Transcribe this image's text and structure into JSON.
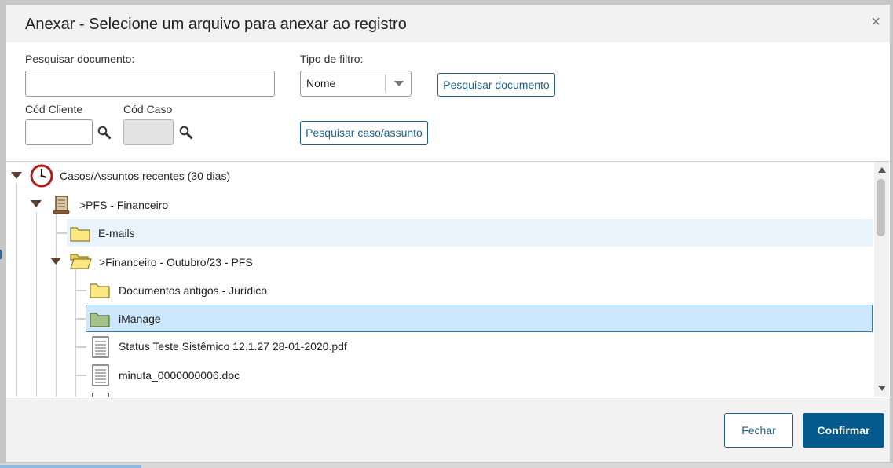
{
  "dialog": {
    "title": "Anexar - Selecione um arquivo para anexar ao registro",
    "close_label": "×"
  },
  "search": {
    "document_label": "Pesquisar documento:",
    "document_value": "",
    "filter_type_label": "Tipo de filtro:",
    "filter_type_value": "Nome",
    "search_document_button": "Pesquisar documento",
    "client_code_label": "Cód Cliente",
    "client_code_value": "",
    "case_code_label": "Cód Caso",
    "case_code_value": "",
    "search_case_button": "Pesquisar caso/assunto"
  },
  "tree": {
    "nodes": [
      {
        "label": "Casos/Assuntos recentes (30 dias)",
        "icon": "clock-icon",
        "expanded": true
      },
      {
        "label": ">PFS - Financeiro",
        "icon": "scroll-icon",
        "expanded": true
      },
      {
        "label": "E-mails",
        "icon": "folder-icon",
        "hovered": true
      },
      {
        "label": ">Financeiro - Outubro/23 - PFS",
        "icon": "folder-open-icon",
        "expanded": true
      },
      {
        "label": "Documentos antigos - Jurídico",
        "icon": "folder-icon"
      },
      {
        "label": "iManage",
        "icon": "folder-green-icon",
        "selected": true
      },
      {
        "label": "Status Teste Sistêmico 12.1.27 28-01-2020.pdf",
        "icon": "document-icon"
      },
      {
        "label": "minuta_0000000006.doc",
        "icon": "document-icon"
      }
    ]
  },
  "footer": {
    "close_button": "Fechar",
    "confirm_button": "Confirmar"
  },
  "colors": {
    "primary": "#045a8d",
    "outline": "#1f5f8b",
    "hover_row": "#e8f3fc",
    "selected_row": "#cce6fb",
    "tree_arrow": "#5b3e30"
  }
}
